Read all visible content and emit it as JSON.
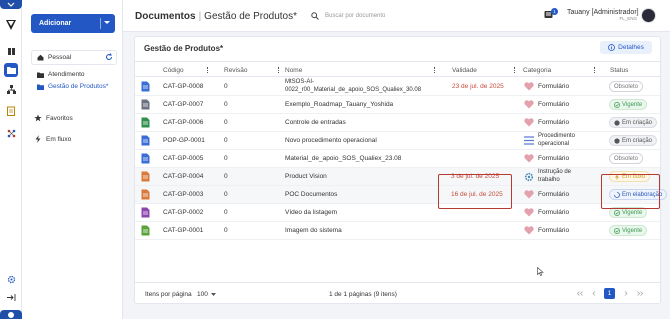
{
  "rail": {
    "icons": [
      "logo-icon",
      "book-icon",
      "folder-icon",
      "org-icon",
      "clipboard-icon",
      "network-icon",
      "settings-icon",
      "collapse-icon",
      "help-icon"
    ]
  },
  "sidebar": {
    "add_button": "Adicionar",
    "personal": "Pessoal",
    "tree": [
      {
        "label": "Atendimento",
        "selected": false
      },
      {
        "label": "Gestão de Produtos*",
        "selected": true
      }
    ],
    "favorites": "Favoritos",
    "in_flow": "Em fluxo"
  },
  "header": {
    "title_main": "Documentos",
    "title_sub": "Gestão de Produtos*",
    "search_placeholder": "Buscar por documento",
    "notif_count": "1",
    "user_name": "Tauany [Administrador]",
    "user_role": "FL_ENG"
  },
  "panel": {
    "title": "Gestão de Produtos*",
    "details_button": "Detalhes",
    "columns": [
      "Código",
      "Revisão",
      "Nome",
      "Validade",
      "Categoria",
      "Status"
    ],
    "rows": [
      {
        "icon_color": "#3a6ed6",
        "code": "CAT-GP-0008",
        "rev": "0",
        "name1": "MtSOS-AI-",
        "name2": "0022_r00_Material_de_apoio_SOS_Qualiex_30.08",
        "validity": "23 de jul. de 2025",
        "validity_red": true,
        "cat_icon": "heart",
        "cat1": "Formulário",
        "cat2": "",
        "status": "Obsoleto",
        "status_kind": "obs"
      },
      {
        "icon_color": "#6b7280",
        "code": "CAT-GP-0007",
        "rev": "0",
        "name1": "Exemplo_Roadmap_Tauany_Yoshida",
        "name2": "",
        "validity": "",
        "validity_red": false,
        "cat_icon": "heart",
        "cat1": "Formulário",
        "cat2": "",
        "status": "Vigente",
        "status_kind": "vig"
      },
      {
        "icon_color": "#2f8f4e",
        "code": "CAT-GP-0006",
        "rev": "0",
        "name1": "Controle de entradas",
        "name2": "",
        "validity": "",
        "validity_red": false,
        "cat_icon": "heart",
        "cat1": "Formulário",
        "cat2": "",
        "status": "Em criação",
        "status_kind": "cri"
      },
      {
        "icon_color": "#3a6ed6",
        "code": "POP-GP-0001",
        "rev": "0",
        "name1": "Novo procedimento operacional",
        "name2": "",
        "validity": "",
        "validity_red": false,
        "cat_icon": "list",
        "cat1": "Procedimento",
        "cat2": "operacional",
        "status": "Em criação",
        "status_kind": "cri"
      },
      {
        "icon_color": "#3a6ed6",
        "code": "CAT-GP-0005",
        "rev": "0",
        "name1": "Material_de_apoio_SOS_Qualiex_23.08",
        "name2": "",
        "validity": "",
        "validity_red": false,
        "cat_icon": "heart",
        "cat1": "Formulário",
        "cat2": "",
        "status": "Obsoleto",
        "status_kind": "obs"
      },
      {
        "icon_color": "#d97a3a",
        "code": "CAT-GP-0004",
        "rev": "0",
        "name1": "Product Vision",
        "name2": "",
        "validity": "3 de jul. de 2025",
        "validity_red": true,
        "cat_icon": "gear",
        "cat1": "Instrução de",
        "cat2": "trabalho",
        "status": "Em fluxo",
        "status_kind": "flux"
      },
      {
        "icon_color": "#d97a3a",
        "code": "CAT-GP-0003",
        "rev": "0",
        "name1": "POC Documentos",
        "name2": "",
        "validity": "16 de jul. de 2025",
        "validity_red": true,
        "cat_icon": "heart",
        "cat1": "Formulário",
        "cat2": "",
        "status": "Em elaboração",
        "status_kind": "elab"
      },
      {
        "icon_color": "#8e44ad",
        "code": "CAT-GP-0002",
        "rev": "0",
        "name1": "Vídeo da listagem",
        "name2": "",
        "validity": "",
        "validity_red": false,
        "cat_icon": "heart",
        "cat1": "Formulário",
        "cat2": "",
        "status": "Vigente",
        "status_kind": "vig"
      },
      {
        "icon_color": "#5aa33a",
        "code": "CAT-GP-0001",
        "rev": "0",
        "name1": "Imagem do sistema",
        "name2": "",
        "validity": "",
        "validity_red": false,
        "cat_icon": "heart",
        "cat1": "Formulário",
        "cat2": "",
        "status": "Vigente",
        "status_kind": "vig"
      }
    ],
    "footer": {
      "per_page_label": "Itens por página",
      "per_page_value": "100",
      "range_text": "1 de 1 páginas (9 itens)",
      "current_page": "1"
    }
  }
}
